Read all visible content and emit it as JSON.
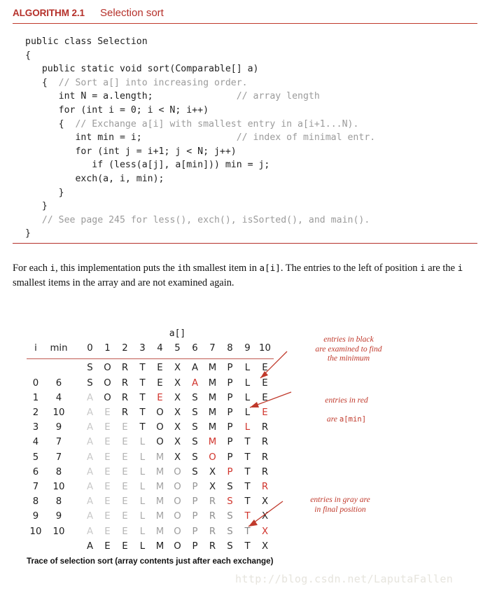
{
  "header": {
    "label": "ALGORITHM 2.1",
    "title": "Selection sort"
  },
  "code": {
    "lines": [
      {
        "text": "public class Selection",
        "comment": ""
      },
      {
        "text": "{",
        "comment": ""
      },
      {
        "text": "   public static void sort(Comparable[] a)",
        "comment": ""
      },
      {
        "text": "   {  ",
        "comment": "// Sort a[] into increasing order."
      },
      {
        "text": "      int N = a.length;               ",
        "comment": "// array length"
      },
      {
        "text": "      for (int i = 0; i < N; i++)",
        "comment": ""
      },
      {
        "text": "      {  ",
        "comment": "// Exchange a[i] with smallest entry in a[i+1...N)."
      },
      {
        "text": "         int min = i;                 ",
        "comment": "// index of minimal entr."
      },
      {
        "text": "         for (int j = i+1; j < N; j++)",
        "comment": ""
      },
      {
        "text": "            if (less(a[j], a[min])) min = j;",
        "comment": ""
      },
      {
        "text": "         exch(a, i, min);",
        "comment": ""
      },
      {
        "text": "      }",
        "comment": ""
      },
      {
        "text": "   }",
        "comment": ""
      },
      {
        "text": "   ",
        "comment": "// See page 245 for less(), exch(), isSorted(), and main()."
      },
      {
        "text": "}",
        "comment": ""
      }
    ]
  },
  "paragraph": {
    "part1": "For each ",
    "mono1": "i",
    "part2": ", this implementation puts the ",
    "mono2": "i",
    "part3": "th smallest item in ",
    "mono3": "a[i]",
    "part4": ". The entries to the left of position ",
    "mono4": "i",
    "part5": " are the ",
    "mono5": "i",
    "part6": " smallest items in the array and are not examined again."
  },
  "trace": {
    "array_caption": "a[]",
    "col_i": "i",
    "col_min": "min",
    "index_headers": [
      "0",
      "1",
      "2",
      "3",
      "4",
      "5",
      "6",
      "7",
      "8",
      "9",
      "10"
    ],
    "initial_row": {
      "i": "",
      "min": "",
      "cells": [
        "S",
        "O",
        "R",
        "T",
        "E",
        "X",
        "A",
        "M",
        "P",
        "L",
        "E"
      ],
      "styles": [
        "black",
        "black",
        "black",
        "black",
        "black",
        "black",
        "black",
        "black",
        "black",
        "black",
        "black"
      ]
    },
    "rows": [
      {
        "i": "0",
        "min": "6",
        "cells": [
          "S",
          "O",
          "R",
          "T",
          "E",
          "X",
          "A",
          "M",
          "P",
          "L",
          "E"
        ],
        "styles": [
          "black",
          "black",
          "black",
          "black",
          "black",
          "black",
          "red",
          "black",
          "black",
          "black",
          "black"
        ]
      },
      {
        "i": "1",
        "min": "4",
        "cells": [
          "A",
          "O",
          "R",
          "T",
          "E",
          "X",
          "S",
          "M",
          "P",
          "L",
          "E"
        ],
        "styles": [
          "g1",
          "black",
          "black",
          "black",
          "red",
          "black",
          "black",
          "black",
          "black",
          "black",
          "black"
        ]
      },
      {
        "i": "2",
        "min": "10",
        "cells": [
          "A",
          "E",
          "R",
          "T",
          "O",
          "X",
          "S",
          "M",
          "P",
          "L",
          "E"
        ],
        "styles": [
          "g1",
          "g2",
          "black",
          "black",
          "black",
          "black",
          "black",
          "black",
          "black",
          "black",
          "red"
        ]
      },
      {
        "i": "3",
        "min": "9",
        "cells": [
          "A",
          "E",
          "E",
          "T",
          "O",
          "X",
          "S",
          "M",
          "P",
          "L",
          "R"
        ],
        "styles": [
          "g1",
          "g2",
          "g3",
          "black",
          "black",
          "black",
          "black",
          "black",
          "black",
          "red",
          "black"
        ]
      },
      {
        "i": "4",
        "min": "7",
        "cells": [
          "A",
          "E",
          "E",
          "L",
          "O",
          "X",
          "S",
          "M",
          "P",
          "T",
          "R"
        ],
        "styles": [
          "g1",
          "g2",
          "g3",
          "g4",
          "black",
          "black",
          "black",
          "red",
          "black",
          "black",
          "black"
        ]
      },
      {
        "i": "5",
        "min": "7",
        "cells": [
          "A",
          "E",
          "E",
          "L",
          "M",
          "X",
          "S",
          "O",
          "P",
          "T",
          "R"
        ],
        "styles": [
          "g1",
          "g2",
          "g3",
          "g4",
          "g5",
          "black",
          "black",
          "red",
          "black",
          "black",
          "black"
        ]
      },
      {
        "i": "6",
        "min": "8",
        "cells": [
          "A",
          "E",
          "E",
          "L",
          "M",
          "O",
          "S",
          "X",
          "P",
          "T",
          "R"
        ],
        "styles": [
          "g1",
          "g2",
          "g3",
          "g4",
          "g5",
          "g6",
          "black",
          "black",
          "red",
          "black",
          "black"
        ]
      },
      {
        "i": "7",
        "min": "10",
        "cells": [
          "A",
          "E",
          "E",
          "L",
          "M",
          "O",
          "P",
          "X",
          "S",
          "T",
          "R"
        ],
        "styles": [
          "g1",
          "g2",
          "g3",
          "g4",
          "g5",
          "g6",
          "g7",
          "black",
          "black",
          "black",
          "red"
        ]
      },
      {
        "i": "8",
        "min": "8",
        "cells": [
          "A",
          "E",
          "E",
          "L",
          "M",
          "O",
          "P",
          "R",
          "S",
          "T",
          "X"
        ],
        "styles": [
          "g1",
          "g2",
          "g3",
          "g4",
          "g5",
          "g6",
          "g7",
          "g8",
          "red",
          "black",
          "black"
        ]
      },
      {
        "i": "9",
        "min": "9",
        "cells": [
          "A",
          "E",
          "E",
          "L",
          "M",
          "O",
          "P",
          "R",
          "S",
          "T",
          "X"
        ],
        "styles": [
          "g1",
          "g2",
          "g3",
          "g4",
          "g5",
          "g6",
          "g7",
          "g8",
          "g9",
          "red",
          "black"
        ]
      },
      {
        "i": "10",
        "min": "10",
        "cells": [
          "A",
          "E",
          "E",
          "L",
          "M",
          "O",
          "P",
          "R",
          "S",
          "T",
          "X"
        ],
        "styles": [
          "g1",
          "g2",
          "g3",
          "g4",
          "g5",
          "g6",
          "g7",
          "g8",
          "g9",
          "g10",
          "red"
        ]
      }
    ],
    "final_row": {
      "i": "",
      "min": "",
      "cells": [
        "A",
        "E",
        "E",
        "L",
        "M",
        "O",
        "P",
        "R",
        "S",
        "T",
        "X"
      ],
      "styles": [
        "black",
        "black",
        "black",
        "black",
        "black",
        "black",
        "black",
        "black",
        "black",
        "black",
        "black"
      ]
    }
  },
  "annotations": {
    "black_note": "entries in black\nare examined to find\nthe minimum",
    "red_note_line1": "entries in red",
    "red_note_line2_pre": "are ",
    "red_note_line2_mono": "a[min]",
    "gray_note": "entries in gray are\nin final position"
  },
  "caption": "Trace of selection sort (array contents just after each exchange)",
  "watermark": "http://blog.csdn.net/LaputaFallen",
  "colors": {
    "accent_red": "#b5302a",
    "value_red": "#d0342c",
    "rule_red": "#c0392b",
    "text_black": "#1d1d1d",
    "comment_gray": "#9b9b9b",
    "watermark_gray": "#e6e4dd"
  }
}
